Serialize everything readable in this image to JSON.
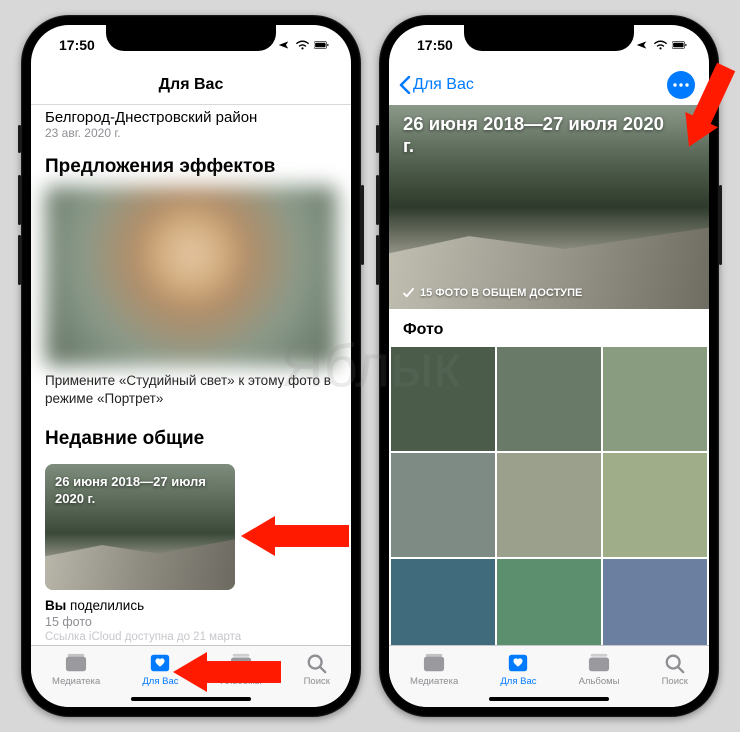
{
  "status": {
    "time": "17:50"
  },
  "phone1": {
    "nav_title": "Для Вас",
    "location_title": "Белгород-Днестровский район",
    "location_date": "23 авг. 2020 г.",
    "effects_heading": "Предложения эффектов",
    "effects_caption": "Примените «Студийный свет» к этому фото в режиме «Портрет»",
    "recent_heading": "Недавние общие",
    "shared_card_title": "26 июня 2018—27 июля 2020 г.",
    "you_shared_label": "Вы",
    "shared_label": "поделились",
    "photo_count": "15 фото",
    "link_note": "Ссылка iCloud доступна до 21 марта"
  },
  "phone2": {
    "back_label": "Для Вас",
    "hero_title": "26 июня 2018—27 июля 2020 г.",
    "hero_subtitle": "15 ФОТО В ОБЩЕМ ДОСТУПЕ",
    "photos_heading": "Фото"
  },
  "tabs": {
    "library": "Медиатека",
    "for_you": "Для Вас",
    "albums": "Альбомы",
    "search": "Поиск"
  },
  "watermark": "Яблык",
  "grid_colors": [
    "#4b5d4a",
    "#6a7a68",
    "#8a9c7f",
    "#7e8b85",
    "#9aa08c",
    "#9fae88",
    "#3f6b7c",
    "#5c8f6e",
    "#6b7fa0"
  ]
}
